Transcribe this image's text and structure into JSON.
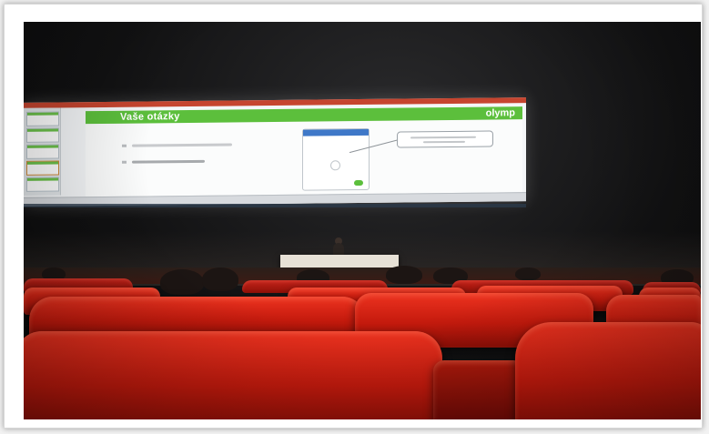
{
  "slide": {
    "title": "Vaše otázky",
    "logo": "olymp"
  },
  "colors": {
    "slide_accent": "#5cbf3c",
    "ribbon": "#c6452f",
    "seat_red": "#d42414",
    "room_dark": "#111112"
  },
  "icons": {
    "phone": "phone-mockup-icon",
    "send": "send-button-icon"
  }
}
